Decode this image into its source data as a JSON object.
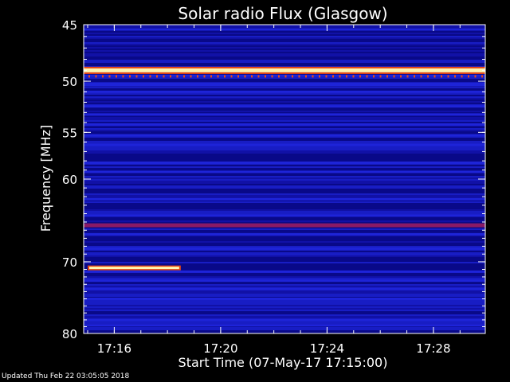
{
  "chart_data": {
    "type": "heatmap",
    "title": "Solar radio Flux (Glasgow)",
    "xlabel": "Start Time (07-May-17 17:15:00)",
    "ylabel": "Frequency [MHz]",
    "x_ticks": [
      "17:16",
      "17:20",
      "17:24",
      "17:28"
    ],
    "x_tick_minutes": [
      16,
      20,
      24,
      28
    ],
    "xlim_minutes": [
      14.85,
      29.95
    ],
    "y_ticks": [
      45,
      50,
      55,
      60,
      70,
      80
    ],
    "ylim": [
      45,
      80
    ],
    "y_scale": "log",
    "colors": {
      "background": "#000000",
      "low": "#0a0a88",
      "mid": "#1e24d8",
      "warm": "#8a1a66",
      "high": "#e84a14",
      "peak": "#fff6b0"
    },
    "bands": [
      {
        "freq": 45.4,
        "level": 0.55
      },
      {
        "freq": 49.0,
        "level": 1.0
      },
      {
        "freq": 49.5,
        "level": 0.45
      },
      {
        "freq": 50.3,
        "level": 0.6
      },
      {
        "freq": 51.0,
        "level": 0.5
      },
      {
        "freq": 52.4,
        "level": 0.45
      },
      {
        "freq": 53.2,
        "level": 0.5
      },
      {
        "freq": 54.2,
        "level": 0.55
      },
      {
        "freq": 55.3,
        "level": 0.5
      },
      {
        "freq": 56.3,
        "level": 0.5
      },
      {
        "freq": 58.2,
        "level": 0.45
      },
      {
        "freq": 59.2,
        "level": 0.45
      },
      {
        "freq": 62.3,
        "level": 0.45
      },
      {
        "freq": 64.2,
        "level": 0.45
      },
      {
        "freq": 65.4,
        "level": 0.7
      },
      {
        "freq": 66.5,
        "level": 0.5
      },
      {
        "freq": 68.3,
        "level": 0.45
      },
      {
        "freq": 71.3,
        "level": 0.45
      },
      {
        "freq": 72.5,
        "level": 0.5
      },
      {
        "freq": 73.6,
        "level": 0.45
      },
      {
        "freq": 75.0,
        "level": 0.5
      },
      {
        "freq": 78.0,
        "level": 0.45
      },
      {
        "freq": 78.8,
        "level": 0.5
      }
    ],
    "bursts": [
      {
        "freq": 70.8,
        "t_start": 15.0,
        "t_end": 18.5,
        "level": 1.0
      }
    ]
  },
  "footer": {
    "updated": "Updated Thu Feb 22 03:05:05 2018"
  }
}
